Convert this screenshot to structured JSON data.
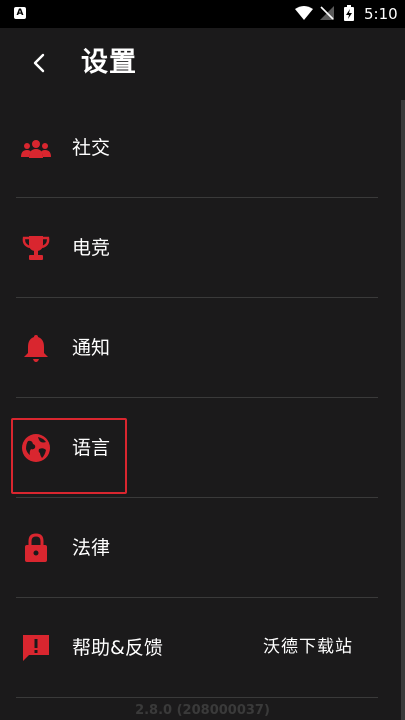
{
  "status_bar": {
    "left_icon_letter": "A",
    "time": "5:10",
    "icons": [
      "app-notification-icon",
      "wifi-icon",
      "no-signal-icon",
      "battery-charging-icon"
    ]
  },
  "header": {
    "title": "设置",
    "back_icon": "chevron-left-icon"
  },
  "menu": {
    "items": [
      {
        "label": "社交",
        "icon": "people-group-icon"
      },
      {
        "label": "电竞",
        "icon": "trophy-icon"
      },
      {
        "label": "通知",
        "icon": "bell-icon"
      },
      {
        "label": "语言",
        "icon": "globe-icon"
      },
      {
        "label": "法律",
        "icon": "lock-icon"
      },
      {
        "label": "帮助&反馈",
        "icon": "feedback-icon"
      }
    ]
  },
  "watermark": "沃德下载站",
  "version": "2.8.0 (208000037)",
  "colors": {
    "accent": "#d9262f",
    "background": "#1b1a1b",
    "divider": "#3a3a3a",
    "text": "#ffffff"
  }
}
